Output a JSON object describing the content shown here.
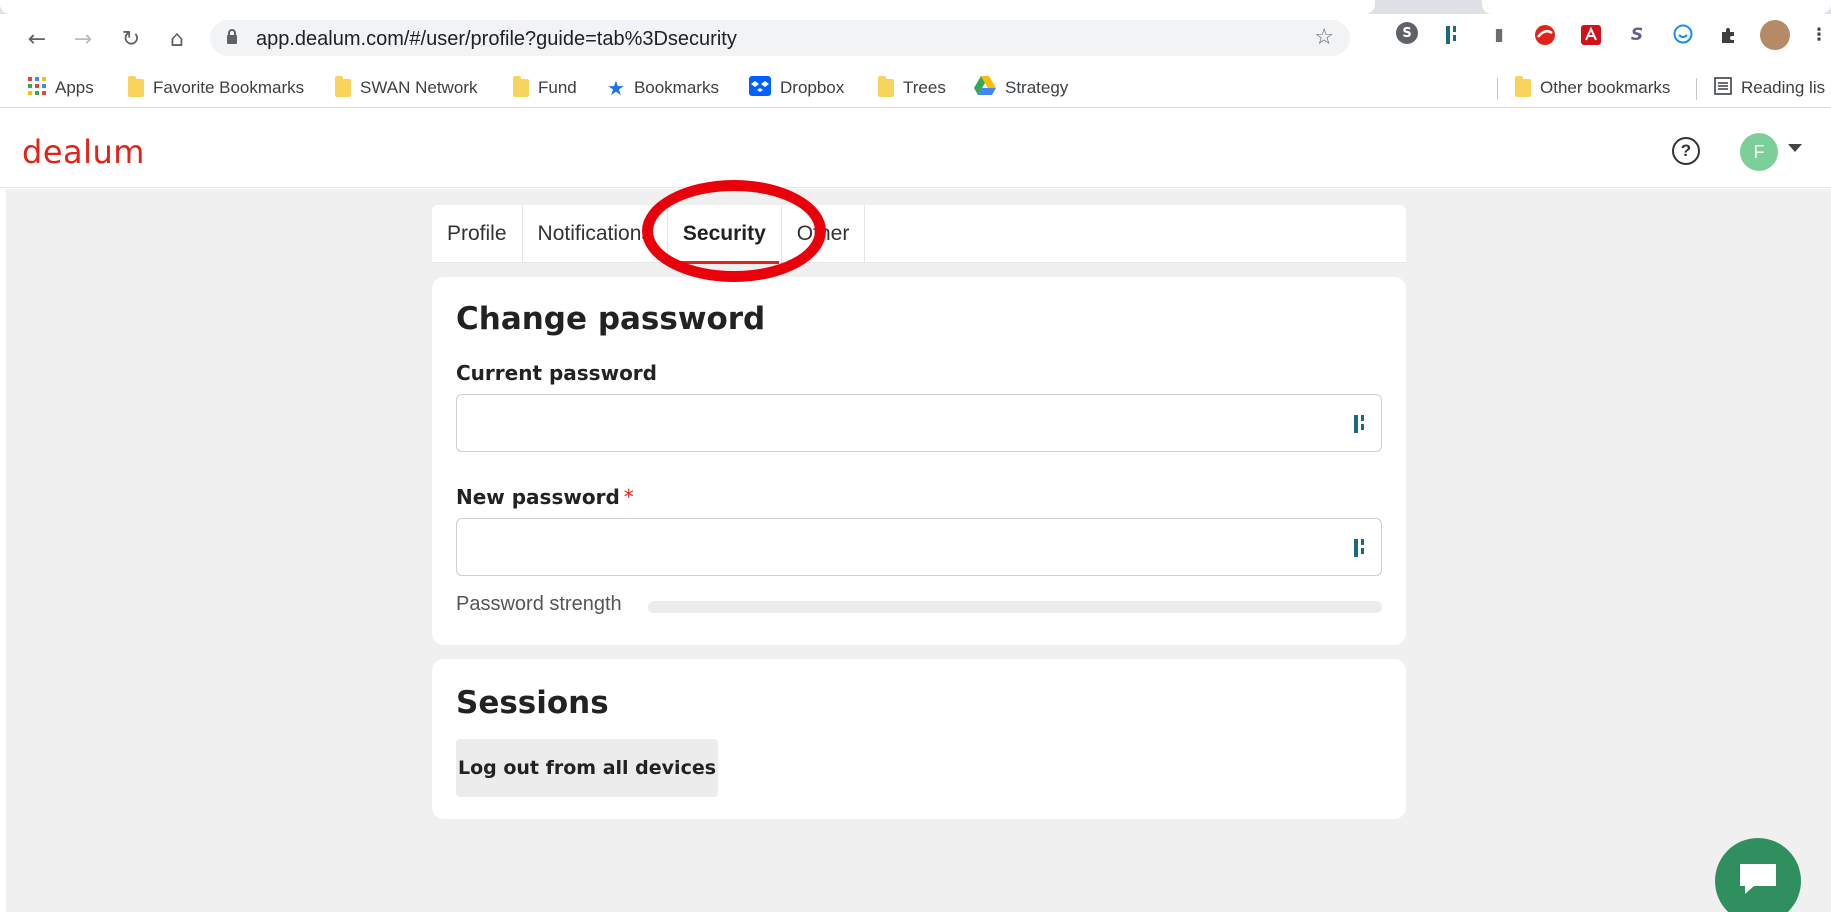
{
  "browser": {
    "url": "app.dealum.com/#/user/profile?guide=tab%3Dsecurity",
    "bookmarks": [
      {
        "label": "Apps",
        "icon": "apps-grid-icon"
      },
      {
        "label": "Favorite Bookmarks",
        "icon": "folder-icon"
      },
      {
        "label": "SWAN Network",
        "icon": "folder-icon"
      },
      {
        "label": "Fund",
        "icon": "folder-icon"
      },
      {
        "label": "Bookmarks",
        "icon": "star-icon"
      },
      {
        "label": "Dropbox",
        "icon": "dropbox-icon"
      },
      {
        "label": "Trees",
        "icon": "folder-icon"
      },
      {
        "label": "Strategy",
        "icon": "google-drive-icon"
      }
    ],
    "other_bookmarks": "Other bookmarks",
    "reading_list": "Reading lis"
  },
  "app": {
    "logo": "dealum",
    "avatar_initial": "F",
    "brand_color": "#e2231a",
    "avatar_color": "#7dcf9a"
  },
  "tabs": [
    {
      "label": "Profile",
      "active": false
    },
    {
      "label": "Notifications",
      "active": false
    },
    {
      "label": "Security",
      "active": true
    },
    {
      "label": "Other",
      "active": false
    }
  ],
  "change_password": {
    "title": "Change password",
    "current_label": "Current password",
    "new_label": "New password",
    "required_marker": "*",
    "strength_label": "Password strength",
    "strength_value": 0
  },
  "sessions": {
    "title": "Sessions",
    "logout_label": "Log out from all devices"
  }
}
